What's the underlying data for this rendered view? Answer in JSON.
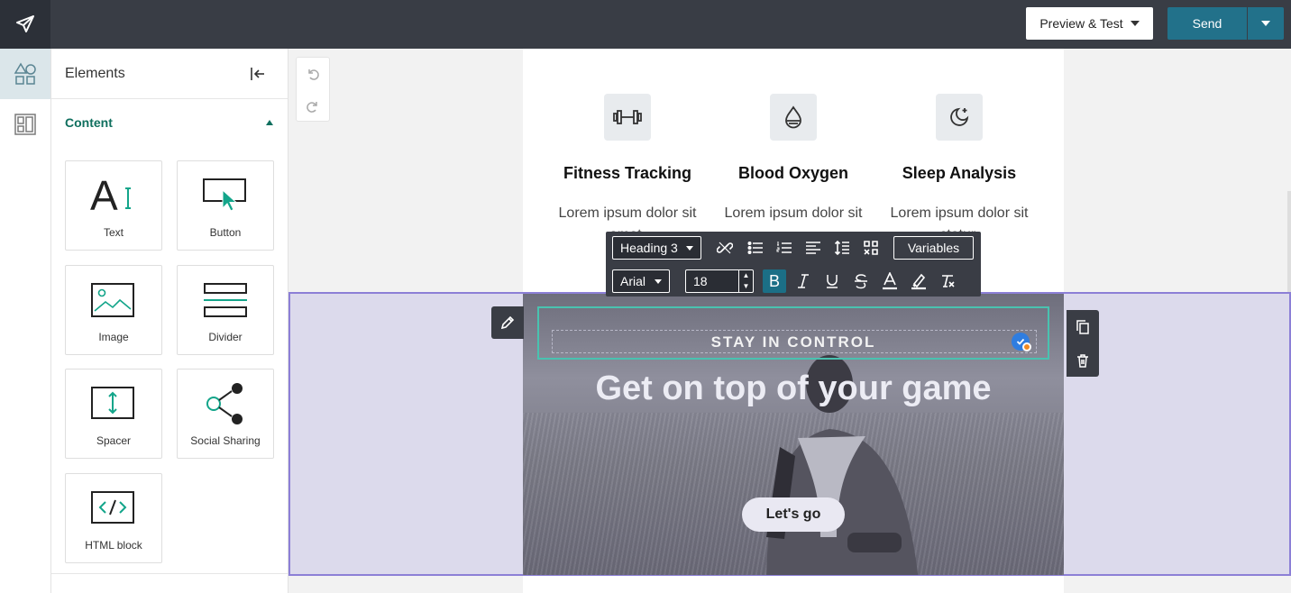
{
  "topbar": {
    "preview_label": "Preview & Test",
    "send_label": "Send"
  },
  "rail": {
    "items": [
      {
        "icon": "shapes-icon",
        "active": true
      },
      {
        "icon": "layout-icon",
        "active": false
      }
    ]
  },
  "panel": {
    "title": "Elements",
    "section_title": "Content",
    "tiles": [
      {
        "label": "Text",
        "icon": "text-icon"
      },
      {
        "label": "Button",
        "icon": "button-icon"
      },
      {
        "label": "Image",
        "icon": "image-icon"
      },
      {
        "label": "Divider",
        "icon": "divider-icon"
      },
      {
        "label": "Spacer",
        "icon": "spacer-icon"
      },
      {
        "label": "Social Sharing",
        "icon": "share-icon"
      },
      {
        "label": "HTML block",
        "icon": "code-icon"
      }
    ]
  },
  "email": {
    "features": [
      {
        "title": "Fitness Tracking",
        "body": "Lorem ipsum dolor sit amet,",
        "icon": "dumbbell-icon"
      },
      {
        "title": "Blood Oxygen",
        "body": "Lorem ipsum dolor sit",
        "icon": "droplet-icon"
      },
      {
        "title": "Sleep Analysis",
        "body": "Lorem ipsum dolor sit ctetur.",
        "icon": "moon-icon"
      }
    ],
    "hero": {
      "eyebrow": "STAY IN CONTROL",
      "heading": "Get on top of your game",
      "button": "Let's go"
    }
  },
  "toolbar": {
    "block_style": "Heading 3",
    "font": "Arial",
    "size": "18",
    "variables_label": "Variables"
  },
  "colors": {
    "accent": "#22718a",
    "selection": "#8c7fd6",
    "text_block_border": "#49c2b0"
  }
}
